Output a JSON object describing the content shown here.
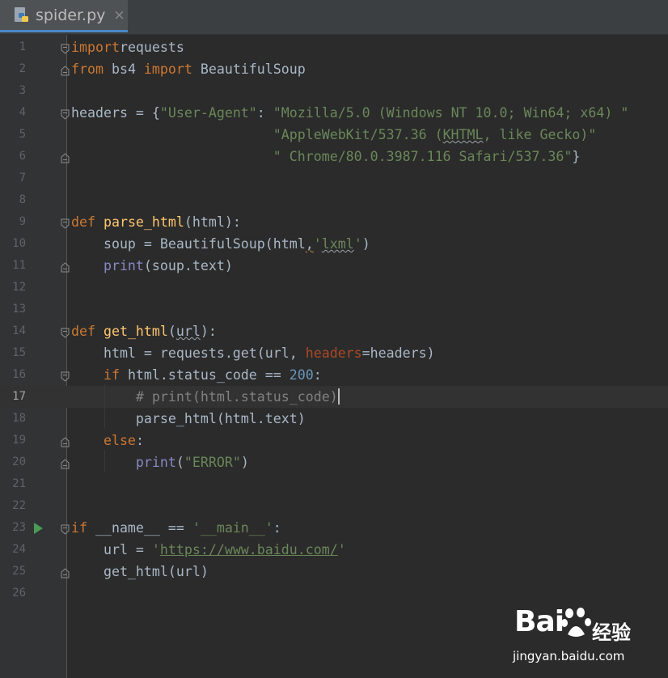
{
  "tab": {
    "filename": "spider.py",
    "close_glyph": "×",
    "icon": "python-file-icon"
  },
  "colors": {
    "background": "#2b2b2b",
    "keyword": "#cc7832",
    "function": "#ffc66d",
    "string": "#6a8759",
    "number": "#6897bb",
    "comment": "#808080",
    "builtin": "#8888c6",
    "param": "#aa4926",
    "text": "#a9b7c6",
    "run_marker": "#499c54"
  },
  "current_line": 17,
  "lines": [
    {
      "n": "1",
      "t": [
        [
          "kw",
          "import"
        ],
        [
          "",
          "requests"
        ]
      ]
    },
    {
      "n": "2",
      "t": [
        [
          "kw",
          "from"
        ],
        [
          "",
          " bs4 "
        ],
        [
          "kw",
          "import"
        ],
        [
          "",
          " BeautifulSoup"
        ]
      ]
    },
    {
      "n": "3",
      "t": []
    },
    {
      "n": "4",
      "t": [
        [
          "",
          "headers = {"
        ],
        [
          "str",
          "\"User-Agent\""
        ],
        [
          "",
          ": "
        ],
        [
          "str",
          "\"Mozilla/5.0 (Windows NT 10.0; Win64; x64) \""
        ]
      ]
    },
    {
      "n": "5",
      "t": [
        [
          "",
          "                         "
        ],
        [
          "str",
          "\"AppleWebKit/537.36 ("
        ],
        [
          "str squig-w",
          "KHTML"
        ],
        [
          "str",
          ", like Gecko)\""
        ]
      ]
    },
    {
      "n": "6",
      "t": [
        [
          "",
          "                         "
        ],
        [
          "str",
          "\" Chrome/80.0.3987.116 Safari/537.36\""
        ],
        [
          "",
          "}"
        ]
      ]
    },
    {
      "n": "7",
      "t": []
    },
    {
      "n": "8",
      "t": []
    },
    {
      "n": "9",
      "t": [
        [
          "kw",
          "def "
        ],
        [
          "fn",
          "parse_html"
        ],
        [
          "",
          "(html):"
        ]
      ]
    },
    {
      "n": "10",
      "t": [
        [
          "",
          "    soup = BeautifulSoup(html"
        ],
        [
          "squig",
          ","
        ],
        [
          "str",
          "'"
        ],
        [
          "str squig-w",
          "lxml"
        ],
        [
          "str",
          "'"
        ],
        [
          "",
          ")"
        ]
      ]
    },
    {
      "n": "11",
      "t": [
        [
          "builtin",
          "    print"
        ],
        [
          "",
          "(soup.text)"
        ]
      ]
    },
    {
      "n": "12",
      "t": []
    },
    {
      "n": "13",
      "t": []
    },
    {
      "n": "14",
      "t": [
        [
          "kw",
          "def "
        ],
        [
          "fn",
          "get_html"
        ],
        [
          "",
          "("
        ],
        [
          "squig-w",
          "url"
        ],
        [
          "",
          "):"
        ]
      ]
    },
    {
      "n": "15",
      "t": [
        [
          "",
          "    html = requests.get(url, "
        ],
        [
          "param",
          "headers"
        ],
        [
          "",
          "=headers)"
        ]
      ]
    },
    {
      "n": "16",
      "t": [
        [
          "kw",
          "    if"
        ],
        [
          "",
          " html.status_code == "
        ],
        [
          "num",
          "200"
        ],
        [
          "",
          ":"
        ]
      ]
    },
    {
      "n": "17",
      "t": [
        [
          "cmt",
          "        # print(html.status_code)"
        ]
      ]
    },
    {
      "n": "18",
      "t": [
        [
          "",
          "        parse_html(html.text)"
        ]
      ]
    },
    {
      "n": "19",
      "t": [
        [
          "kw",
          "    else"
        ],
        [
          "",
          ":"
        ]
      ]
    },
    {
      "n": "20",
      "t": [
        [
          "builtin",
          "        print"
        ],
        [
          "",
          "("
        ],
        [
          "str",
          "\"ERROR\""
        ],
        [
          "",
          ")"
        ]
      ]
    },
    {
      "n": "21",
      "t": []
    },
    {
      "n": "22",
      "t": []
    },
    {
      "n": "23",
      "t": [
        [
          "kw",
          "if"
        ],
        [
          "",
          " __name__ == "
        ],
        [
          "str",
          "'__main__'"
        ],
        [
          "",
          ":"
        ]
      ]
    },
    {
      "n": "24",
      "t": [
        [
          "",
          "    url = "
        ],
        [
          "str",
          "'"
        ],
        [
          "link",
          "https://www.baidu.com/"
        ],
        [
          "str",
          "'"
        ]
      ]
    },
    {
      "n": "25",
      "t": [
        [
          "",
          "    get_html(url)"
        ]
      ]
    },
    {
      "n": "26",
      "t": []
    }
  ],
  "folds": {
    "open": [
      "1",
      "4",
      "9",
      "14",
      "16",
      "23"
    ],
    "close": [
      "2",
      "6",
      "11",
      "19",
      "20",
      "25"
    ],
    "bar": [
      "17",
      "18"
    ]
  },
  "run_marker_line": "23",
  "watermark": {
    "brand": "Bai",
    "brand_cn": "经验",
    "url": "jingyan.baidu.com",
    "paw_icon": "baidu-paw-icon"
  }
}
